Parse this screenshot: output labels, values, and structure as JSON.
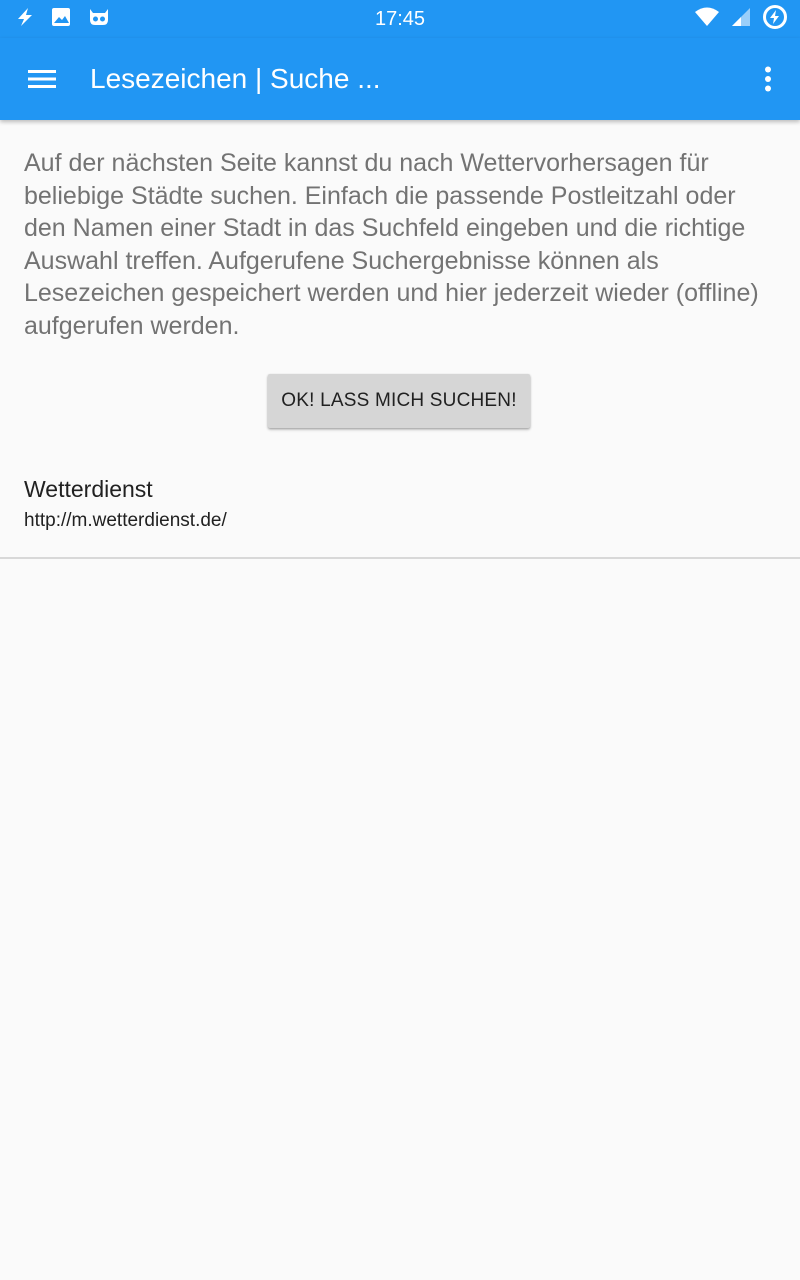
{
  "status_bar": {
    "time": "17:45",
    "left_icons": [
      "flash-icon",
      "image-icon",
      "cyanogenmod-icon"
    ],
    "right_icons": [
      "wifi-icon",
      "signal-icon",
      "battery-charging-icon"
    ]
  },
  "app_bar": {
    "menu_icon": "hamburger-menu-icon",
    "title": "Lesezeichen | Suche ...",
    "overflow_icon": "more-vert-icon",
    "color": "#2196f3"
  },
  "content": {
    "intro_text": "Auf der nächsten Seite kannst du nach Wettervorhersagen für beliebige Städte suchen. Einfach die passende Postleitzahl oder den Namen einer Stadt in das Suchfeld eingeben und die richtige Auswahl treffen. Aufgerufene Suchergebnisse können als Lesezeichen gespeichert werden und hier jederzeit wieder (offline) aufgerufen werden.",
    "search_button_label": "OK! LASS MICH SUCHEN!"
  },
  "bookmarks": [
    {
      "title": "Wetterdienst",
      "url": "http://m.wetterdienst.de/"
    }
  ]
}
